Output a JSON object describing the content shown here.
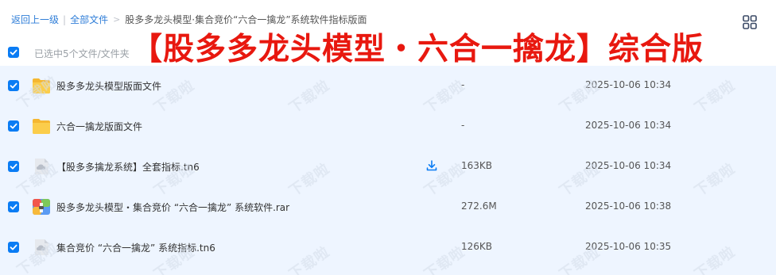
{
  "breadcrumb": {
    "back": "返回上一级",
    "separator": "|",
    "all_files": "全部文件",
    "arrow": ">",
    "current": "股多多龙头模型·集合竞价“六合一擒龙”系统软件指标版面"
  },
  "header": {
    "selected_text": "已选中5个文件/文件夹",
    "banner": "【股多多龙头模型・六合一擒龙】综合版"
  },
  "watermark_text": "下载啦",
  "files": [
    {
      "name": "股多多龙头模型版面文件",
      "size": "-",
      "date": "2025-10-06 10:34",
      "icon": "folder-icon"
    },
    {
      "name": "六合一擒龙版面文件",
      "size": "-",
      "date": "2025-10-06 10:34",
      "icon": "folder-icon"
    },
    {
      "name": "【股多多擒龙系统】全套指标.tn6",
      "size": "163KB",
      "date": "2025-10-06 10:34",
      "icon": "cloud-file-icon"
    },
    {
      "name": "股多多龙头模型・集合竞价 “六合一擒龙” 系统软件.rar",
      "size": "272.6M",
      "date": "2025-10-06 10:38",
      "icon": "archive-icon"
    },
    {
      "name": "集合竞价 “六合一擒龙” 系统指标.tn6",
      "size": "126KB",
      "date": "2025-10-06 10:35",
      "icon": "cloud-file-icon"
    }
  ],
  "colors": {
    "accent": "#0a7cf4",
    "banner": "#e8180f",
    "row_bg": "#eef5ff",
    "folder": "#f7c544"
  }
}
